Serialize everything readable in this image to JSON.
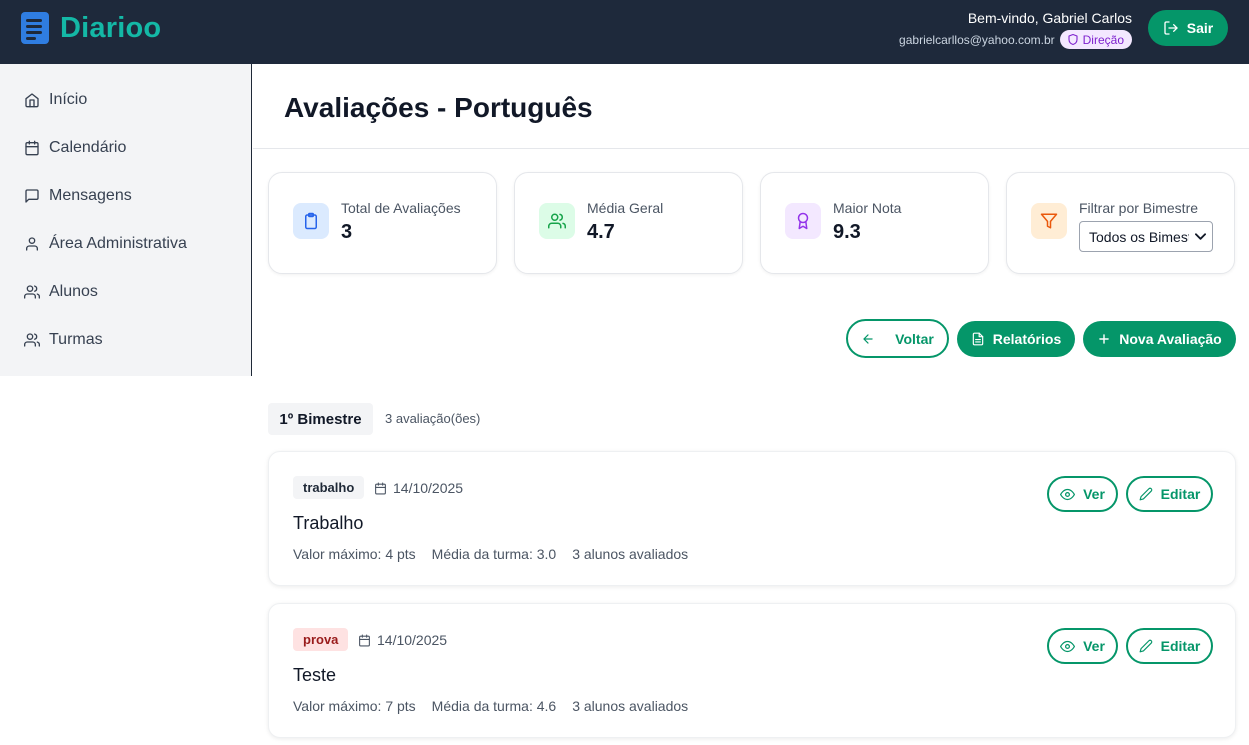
{
  "app": {
    "name": "Diarioo"
  },
  "header": {
    "welcome": "Bem-vindo, Gabriel Carlos",
    "email": "gabrielcarllos@yahoo.com.br",
    "role": "Direção",
    "logout_label": "Sair"
  },
  "sidebar": {
    "items": [
      {
        "label": "Início",
        "icon": "home-icon"
      },
      {
        "label": "Calendário",
        "icon": "calendar-icon"
      },
      {
        "label": "Mensagens",
        "icon": "message-icon"
      },
      {
        "label": "Área Administrativa",
        "icon": "user-icon"
      },
      {
        "label": "Alunos",
        "icon": "users-icon"
      },
      {
        "label": "Turmas",
        "icon": "users-icon"
      }
    ]
  },
  "page": {
    "title": "Avaliações - Português"
  },
  "stats": [
    {
      "label": "Total de Avaliações",
      "value": "3",
      "icon": "clipboard-icon",
      "color": "#2563eb"
    },
    {
      "label": "Média Geral",
      "value": "4.7",
      "icon": "users-icon",
      "color": "#16a34a"
    },
    {
      "label": "Maior Nota",
      "value": "9.3",
      "icon": "award-icon",
      "color": "#9333ea"
    }
  ],
  "filter": {
    "label": "Filtrar por Bimestre",
    "selected": "Todos os Bimestres",
    "icon": "filter-icon",
    "color": "#ea580c"
  },
  "actions": {
    "back_label": "Voltar",
    "reports_label": "Relatórios",
    "new_label": "Nova Avaliação"
  },
  "bimestre": {
    "label": "1º Bimestre",
    "count": "3 avaliação(ões)"
  },
  "evaluations": [
    {
      "type": "trabalho",
      "date": "14/10/2025",
      "title": "Trabalho",
      "max_value": "Valor máximo: 4 pts",
      "class_avg": "Média da turma: 3.0",
      "evaluated": "3 alunos avaliados",
      "view_label": "Ver",
      "edit_label": "Editar"
    },
    {
      "type": "prova",
      "date": "14/10/2025",
      "title": "Teste",
      "max_value": "Valor máximo: 7 pts",
      "class_avg": "Média da turma: 4.6",
      "evaluated": "3 alunos avaliados",
      "view_label": "Ver",
      "edit_label": "Editar"
    }
  ],
  "colors": {
    "brand": "#14b8a6",
    "primary": "#059669",
    "topbar": "#1e293b"
  }
}
